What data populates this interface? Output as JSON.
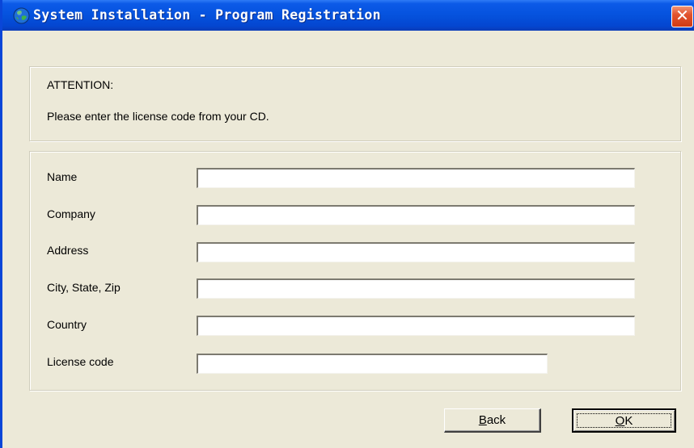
{
  "window": {
    "title": "System Installation - Program Registration",
    "close_glyph": "✕",
    "icon": "globe-icon"
  },
  "attention": {
    "heading": "ATTENTION:",
    "message": "Please enter the license code from your CD."
  },
  "form": {
    "fields": [
      {
        "label": "Name",
        "value": ""
      },
      {
        "label": "Company",
        "value": ""
      },
      {
        "label": "Address",
        "value": ""
      },
      {
        "label": "City, State, Zip",
        "value": ""
      },
      {
        "label": "Country",
        "value": ""
      },
      {
        "label": "License code",
        "value": ""
      }
    ]
  },
  "buttons": {
    "back_accel": "B",
    "back_rest": "ack",
    "ok_accel": "O",
    "ok_rest": "K"
  },
  "colors": {
    "titlebar": "#0552dd",
    "dialog_bg": "#ece9d8",
    "close": "#e2532e"
  }
}
